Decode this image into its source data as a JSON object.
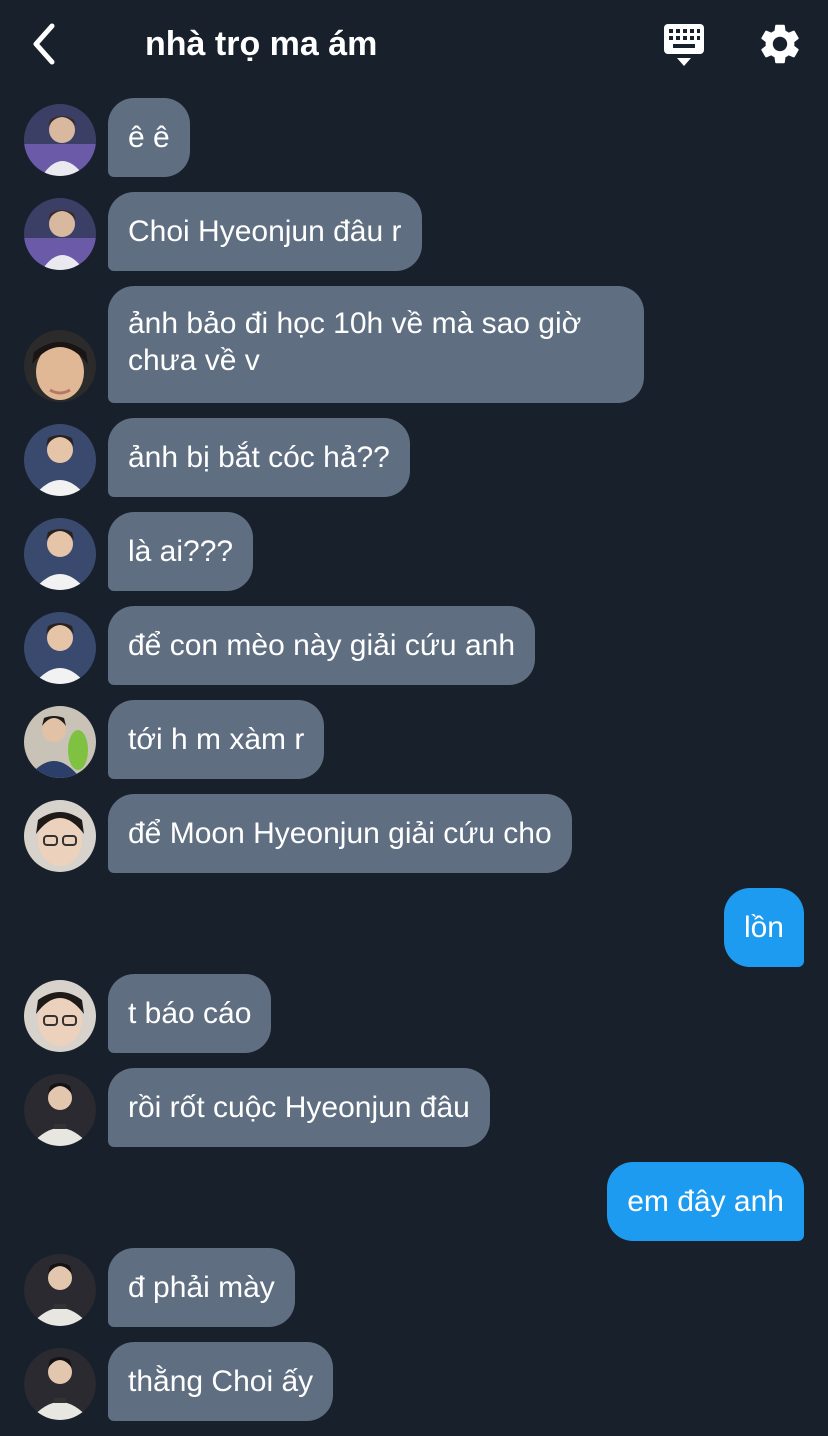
{
  "header": {
    "title": "nhà trọ ma ám",
    "back_icon": "chevron-left-icon",
    "keyboard_icon": "keyboard-icon",
    "settings_icon": "gear-icon"
  },
  "colors": {
    "background": "#18202b",
    "incoming_bubble": "#5f6f81",
    "outgoing_bubble": "#1d9bf0"
  },
  "messages": [
    {
      "direction": "in",
      "text": "ê ê"
    },
    {
      "direction": "in",
      "text": "Choi Hyeonjun đâu r"
    },
    {
      "direction": "in",
      "text": "ảnh bảo đi học 10h về mà sao giờ chưa về v"
    },
    {
      "direction": "in",
      "text": "ảnh bị bắt cóc hả??"
    },
    {
      "direction": "in",
      "text": "là ai???"
    },
    {
      "direction": "in",
      "text": "để con mèo này giải cứu anh"
    },
    {
      "direction": "in",
      "text": "tới h m xàm r"
    },
    {
      "direction": "in",
      "text": "để Moon Hyeonjun giải cứu cho"
    },
    {
      "direction": "out",
      "text": "lồn"
    },
    {
      "direction": "in",
      "text": "t báo cáo"
    },
    {
      "direction": "in",
      "text": "rồi rốt cuộc Hyeonjun đâu"
    },
    {
      "direction": "out",
      "text": "em đây anh"
    },
    {
      "direction": "in",
      "text": "đ phải mày"
    },
    {
      "direction": "in",
      "text": "thằng Choi ấy"
    }
  ]
}
